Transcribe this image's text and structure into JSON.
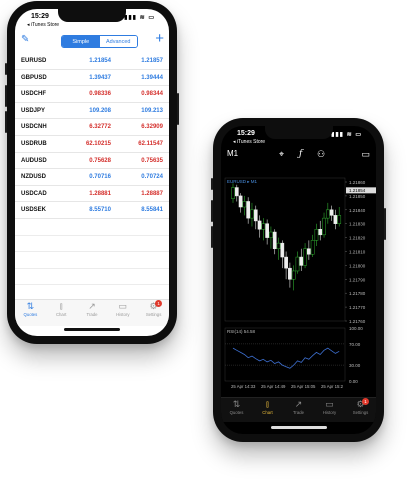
{
  "status": {
    "time": "15:29",
    "back_label": "◂ iTunes Store",
    "signal": "▮▮▮ ≋ ▭"
  },
  "quotes": {
    "toolbar": {
      "edit_icon": "pencil-icon",
      "add_label": "+",
      "mode_simple": "Simple",
      "mode_advanced": "Advanced"
    },
    "rows": [
      {
        "symbol": "EURUSD",
        "bid": "1.21854",
        "ask": "1.21857",
        "color": "#2f7ce0"
      },
      {
        "symbol": "GBPUSD",
        "bid": "1.39437",
        "ask": "1.39444",
        "color": "#2f7ce0"
      },
      {
        "symbol": "USDCHF",
        "bid": "0.98336",
        "ask": "0.98344",
        "color": "#d4302d"
      },
      {
        "symbol": "USDJPY",
        "bid": "109.208",
        "ask": "109.213",
        "color": "#2f7ce0"
      },
      {
        "symbol": "USDCNH",
        "bid": "6.32772",
        "ask": "6.32909",
        "color": "#d4302d"
      },
      {
        "symbol": "USDRUB",
        "bid": "62.10215",
        "ask": "62.11547",
        "color": "#d4302d"
      },
      {
        "symbol": "AUDUSD",
        "bid": "0.75628",
        "ask": "0.75635",
        "color": "#d4302d"
      },
      {
        "symbol": "NZDUSD",
        "bid": "0.70716",
        "ask": "0.70724",
        "color": "#2f7ce0"
      },
      {
        "symbol": "USDCAD",
        "bid": "1.28881",
        "ask": "1.28887",
        "color": "#d4302d"
      },
      {
        "symbol": "USDSEK",
        "bid": "8.55710",
        "ask": "8.55841",
        "color": "#2f7ce0"
      }
    ]
  },
  "tabs": [
    {
      "label": "Quotes",
      "icon": "quotes-icon"
    },
    {
      "label": "Chart",
      "icon": "chart-icon"
    },
    {
      "label": "Trade",
      "icon": "trade-icon"
    },
    {
      "label": "History",
      "icon": "history-icon"
    },
    {
      "label": "Settings",
      "icon": "settings-icon",
      "badge": "1"
    }
  ],
  "chart": {
    "timeframe": "M1",
    "symbol_label": "EURUSD ▸ M1",
    "indicator_label": "RSI(14) 54.58",
    "toolbar_icons": [
      "crosshair-icon",
      "function-icon",
      "objects-icon",
      "windows-icon"
    ]
  },
  "chart_data": {
    "type": "candlestick",
    "title": "EURUSD ▸ M1",
    "price_ticks": [
      "1.21860",
      "1.21850",
      "1.21840",
      "1.21830",
      "1.21820",
      "1.21810",
      "1.21800",
      "1.21790",
      "1.21780",
      "1.21770",
      "1.21760"
    ],
    "price_marker": "1.21854",
    "time_ticks": [
      "25 Apr 14:33",
      "25 Apr 14:49",
      "25 Apr 15:05",
      "25 Apr 15:2"
    ],
    "candles": [
      {
        "o": 1.21848,
        "c": 1.21856,
        "h": 1.21859,
        "l": 1.21845
      },
      {
        "o": 1.21856,
        "c": 1.2185,
        "h": 1.21858,
        "l": 1.21846
      },
      {
        "o": 1.2185,
        "c": 1.21842,
        "h": 1.21852,
        "l": 1.21838
      },
      {
        "o": 1.21842,
        "c": 1.21846,
        "h": 1.2185,
        "l": 1.21836
      },
      {
        "o": 1.21846,
        "c": 1.21834,
        "h": 1.21849,
        "l": 1.2183
      },
      {
        "o": 1.21834,
        "c": 1.2184,
        "h": 1.21845,
        "l": 1.21828
      },
      {
        "o": 1.2184,
        "c": 1.21832,
        "h": 1.21843,
        "l": 1.21826
      },
      {
        "o": 1.21832,
        "c": 1.21826,
        "h": 1.21836,
        "l": 1.2182
      },
      {
        "o": 1.21826,
        "c": 1.2183,
        "h": 1.21834,
        "l": 1.21818
      },
      {
        "o": 1.2183,
        "c": 1.2182,
        "h": 1.21833,
        "l": 1.21815
      },
      {
        "o": 1.2182,
        "c": 1.21824,
        "h": 1.21828,
        "l": 1.21812
      },
      {
        "o": 1.21824,
        "c": 1.21812,
        "h": 1.21826,
        "l": 1.21808
      },
      {
        "o": 1.21812,
        "c": 1.21816,
        "h": 1.2182,
        "l": 1.21804
      },
      {
        "o": 1.21816,
        "c": 1.21806,
        "h": 1.21818,
        "l": 1.21798
      },
      {
        "o": 1.21806,
        "c": 1.21798,
        "h": 1.2181,
        "l": 1.2179
      },
      {
        "o": 1.21798,
        "c": 1.2179,
        "h": 1.21802,
        "l": 1.21784
      },
      {
        "o": 1.2179,
        "c": 1.21796,
        "h": 1.218,
        "l": 1.21782
      },
      {
        "o": 1.21796,
        "c": 1.21806,
        "h": 1.2181,
        "l": 1.21794
      },
      {
        "o": 1.21806,
        "c": 1.218,
        "h": 1.21812,
        "l": 1.21796
      },
      {
        "o": 1.218,
        "c": 1.21812,
        "h": 1.21816,
        "l": 1.21798
      },
      {
        "o": 1.21812,
        "c": 1.21808,
        "h": 1.21818,
        "l": 1.21804
      },
      {
        "o": 1.21808,
        "c": 1.21818,
        "h": 1.21822,
        "l": 1.21806
      },
      {
        "o": 1.21818,
        "c": 1.21826,
        "h": 1.2183,
        "l": 1.21814
      },
      {
        "o": 1.21826,
        "c": 1.21822,
        "h": 1.21832,
        "l": 1.21818
      },
      {
        "o": 1.21822,
        "c": 1.21834,
        "h": 1.21838,
        "l": 1.2182
      },
      {
        "o": 1.21834,
        "c": 1.2184,
        "h": 1.21845,
        "l": 1.2183
      },
      {
        "o": 1.2184,
        "c": 1.21836,
        "h": 1.21843,
        "l": 1.21832
      },
      {
        "o": 1.21836,
        "c": 1.2183,
        "h": 1.2184,
        "l": 1.21826
      },
      {
        "o": 1.2183,
        "c": 1.21836,
        "h": 1.21842,
        "l": 1.21828
      }
    ],
    "rsi_ticks": [
      "100.00",
      "70.00",
      "30.00",
      "0.00"
    ],
    "rsi": [
      62,
      58,
      54,
      50,
      44,
      47,
      42,
      38,
      41,
      36,
      39,
      33,
      36,
      30,
      27,
      24,
      30,
      38,
      35,
      44,
      41,
      48,
      54,
      50,
      58,
      62,
      57,
      52,
      56
    ]
  }
}
